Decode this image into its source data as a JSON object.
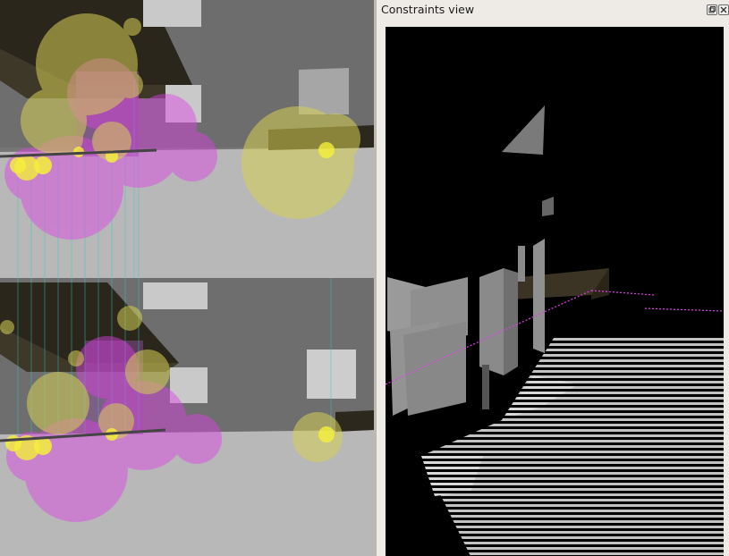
{
  "dock": {
    "title": "Constraints view",
    "float_button": "",
    "close_button": ""
  },
  "colors": {
    "scene_background": "#7a7a7a",
    "ground": "#b8b8b8",
    "constraint_yellow": "#e6e055",
    "constraint_magenta": "#e040e8",
    "correspondence_line": "#37c6c6",
    "constraints_background": "#000000"
  },
  "icons": {
    "float": "float-icon",
    "close": "close-icon"
  }
}
